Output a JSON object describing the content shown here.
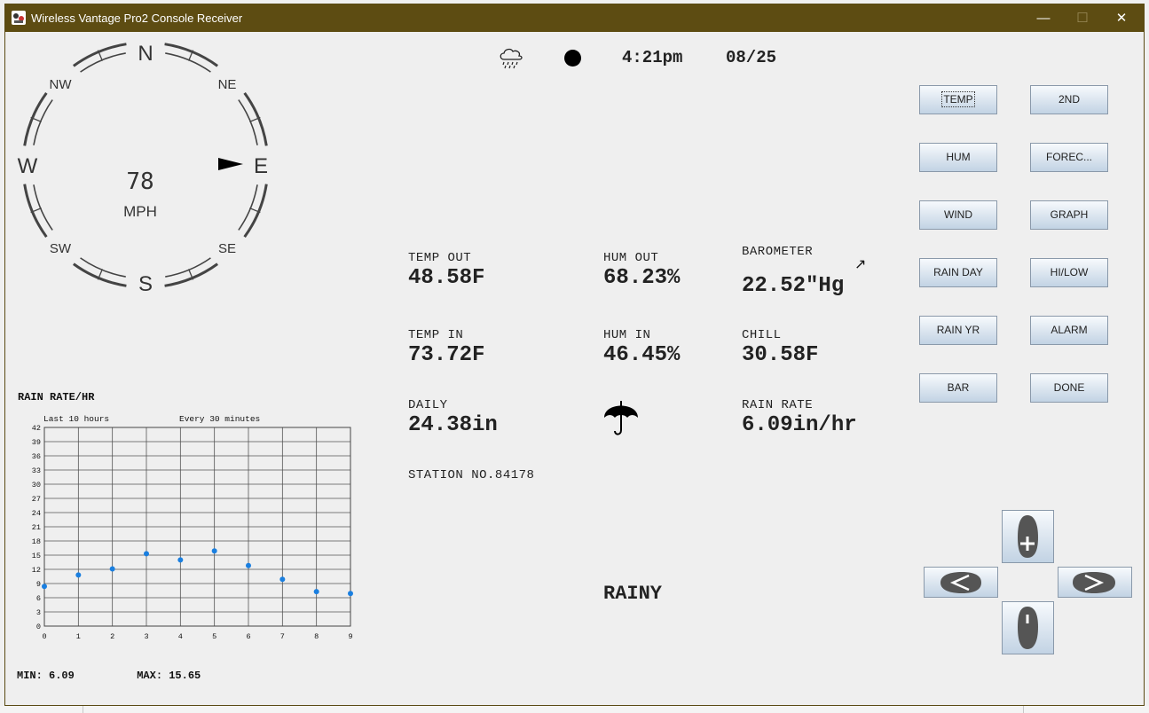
{
  "window": {
    "title": "Wireless Vantage Pro2 Console Receiver",
    "controls": {
      "minimize": "—",
      "maximize": "☐",
      "close": "✕"
    }
  },
  "compass": {
    "directions": {
      "n": "N",
      "ne": "NE",
      "e": "E",
      "se": "SE",
      "s": "S",
      "sw": "SW",
      "w": "W",
      "nw": "NW"
    },
    "wind_direction": "E",
    "speed": "78",
    "unit": "MPH"
  },
  "status": {
    "icon": "cloud-rain-icon",
    "time": "4:21pm",
    "date": "08/25"
  },
  "readings": {
    "temp_out": {
      "label": "TEMP OUT",
      "value": "48.58F"
    },
    "hum_out": {
      "label": "HUM OUT",
      "value": "68.23%"
    },
    "barometer": {
      "label": "BAROMETER",
      "value": "22.52\"Hg",
      "trend": "↗"
    },
    "temp_in": {
      "label": "TEMP IN",
      "value": "73.72F"
    },
    "hum_in": {
      "label": "HUM IN",
      "value": "46.45%"
    },
    "chill": {
      "label": "CHILL",
      "value": "30.58F"
    },
    "daily": {
      "label": "DAILY",
      "value": "24.38in"
    },
    "rain_rate": {
      "label": "RAIN RATE",
      "value": "6.09in/hr"
    },
    "station": "STATION NO.84178",
    "forecast_icon": "umbrella-icon",
    "forecast": "RAINY"
  },
  "buttons": {
    "temp": "TEMP",
    "second": "2ND",
    "hum": "HUM",
    "forecast": "FOREC...",
    "wind": "WIND",
    "graph": "GRAPH",
    "rain_day": "RAIN DAY",
    "hilow": "HI/LOW",
    "rain_yr": "RAIN YR",
    "alarm": "ALARM",
    "bar": "BAR",
    "done": "DONE"
  },
  "chart_data": {
    "type": "scatter",
    "title": "RAIN RATE/HR",
    "annotations": [
      "Last 10 hours",
      "Every 30 minutes"
    ],
    "x": [
      0,
      1,
      2,
      3,
      4,
      5,
      6,
      7,
      8,
      9
    ],
    "y": [
      8.4,
      10.8,
      12.1,
      15.3,
      14.0,
      15.9,
      12.8,
      9.9,
      7.3,
      6.9
    ],
    "xlim": [
      0,
      9
    ],
    "ylim": [
      0,
      42
    ],
    "yticks": [
      0,
      3,
      6,
      9,
      12,
      15,
      18,
      21,
      24,
      27,
      30,
      33,
      36,
      39,
      42
    ],
    "xticks": [
      0,
      1,
      2,
      3,
      4,
      5,
      6,
      7,
      8,
      9
    ],
    "grid": true,
    "point_color": "#1a7fe0",
    "min_label": "MIN: 6.09",
    "max_label": "MAX: 15.65"
  }
}
